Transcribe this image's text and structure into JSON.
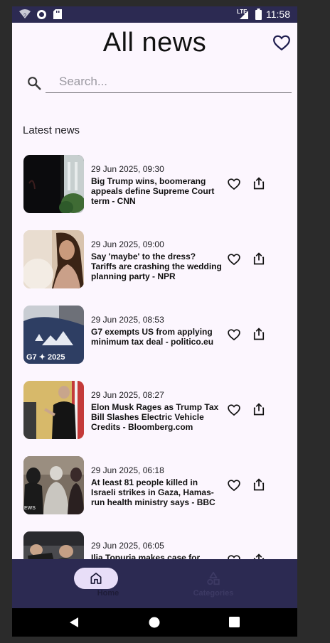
{
  "status_bar": {
    "time": "11:58",
    "network_label": "LTE",
    "icons": [
      "wifi-icon",
      "circle-app-icon",
      "sd-card-icon",
      "signal-icon",
      "battery-icon"
    ]
  },
  "header": {
    "title": "All news",
    "favorites_icon": "heart-outline-icon"
  },
  "search": {
    "placeholder": "Search...",
    "value": ""
  },
  "section": {
    "title": "Latest news"
  },
  "articles": [
    {
      "date": "29 Jun 2025, 09:30",
      "headline": "Big Trump wins, boomerang appeals define Supreme Court term - CNN"
    },
    {
      "date": "29 Jun 2025, 09:00",
      "headline": "Say 'maybe' to the dress? Tariffs are crashing the wedding planning party - NPR"
    },
    {
      "date": "29 Jun 2025, 08:53",
      "headline": "G7 exempts US from applying minimum tax deal - politico.eu",
      "thumb_text": "G7 ✦ 2025"
    },
    {
      "date": "29 Jun 2025, 08:27",
      "headline": "Elon Musk Rages as Trump Tax Bill Slashes Electric Vehicle Credits - Bloomberg.com"
    },
    {
      "date": "29 Jun 2025, 06:18",
      "headline": "At least 81 people killed in Israeli strikes in Gaza, Hamas-run health ministry says - BBC",
      "thumb_text": "EWS"
    },
    {
      "date": "29 Jun 2025, 06:05",
      "headline": "Ilia Topuria makes case for being"
    }
  ],
  "bottom_nav": {
    "items": [
      {
        "label": "Home",
        "icon": "home-icon",
        "selected": true
      },
      {
        "label": "Categories",
        "icon": "categories-icon",
        "selected": false
      }
    ]
  },
  "system_nav": {
    "buttons": [
      "back-icon",
      "home-circle-icon",
      "recents-icon"
    ]
  },
  "colors": {
    "background": "#fcf6fe",
    "status_bar": "#2c2a52",
    "nav_bar": "#2c2a52",
    "nav_selected_pill": "#e8def8",
    "icon_dark": "#1c1b4d"
  }
}
